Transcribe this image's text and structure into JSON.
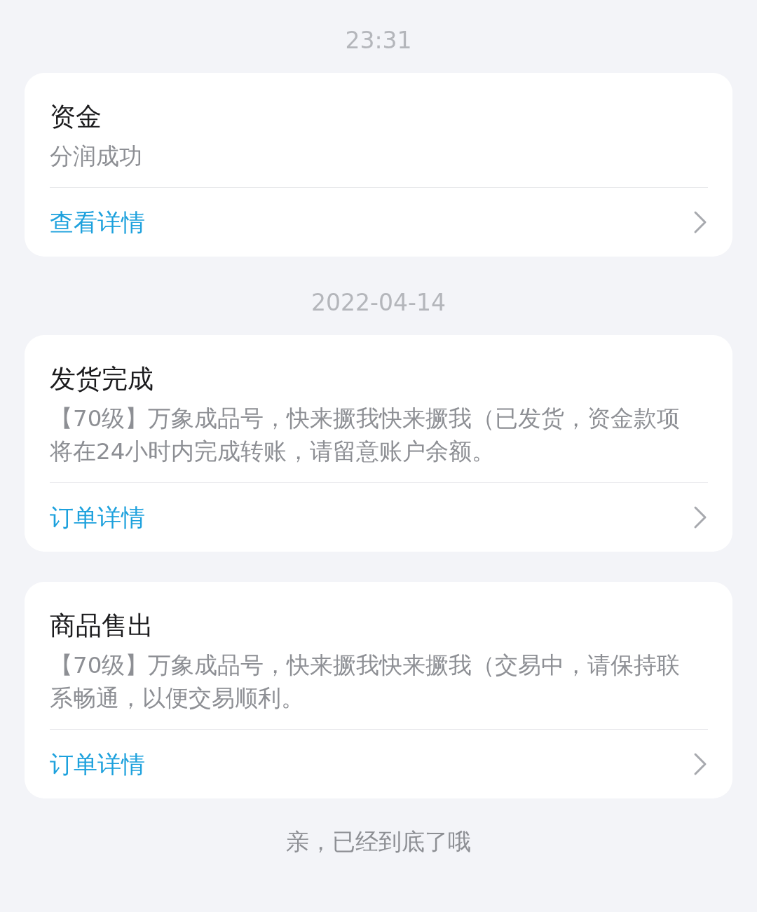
{
  "feed": [
    {
      "kind": "time",
      "text": "23:31"
    },
    {
      "kind": "card",
      "title": "资金",
      "body": "分润成功",
      "link": "查看详情"
    },
    {
      "kind": "time",
      "text": "2022-04-14"
    },
    {
      "kind": "card",
      "title": "发货完成",
      "body": "【70级】万象成品号，快来撅我快来撅我（已发货，资金款项将在24小时内完成转账，请留意账户余额。",
      "link": "订单详情"
    },
    {
      "kind": "card",
      "title": "商品售出",
      "body": "【70级】万象成品号，快来撅我快来撅我（交易中，请保持联系畅通，以便交易顺利。",
      "link": "订单详情"
    }
  ],
  "footer": "亲，已经到底了哦"
}
